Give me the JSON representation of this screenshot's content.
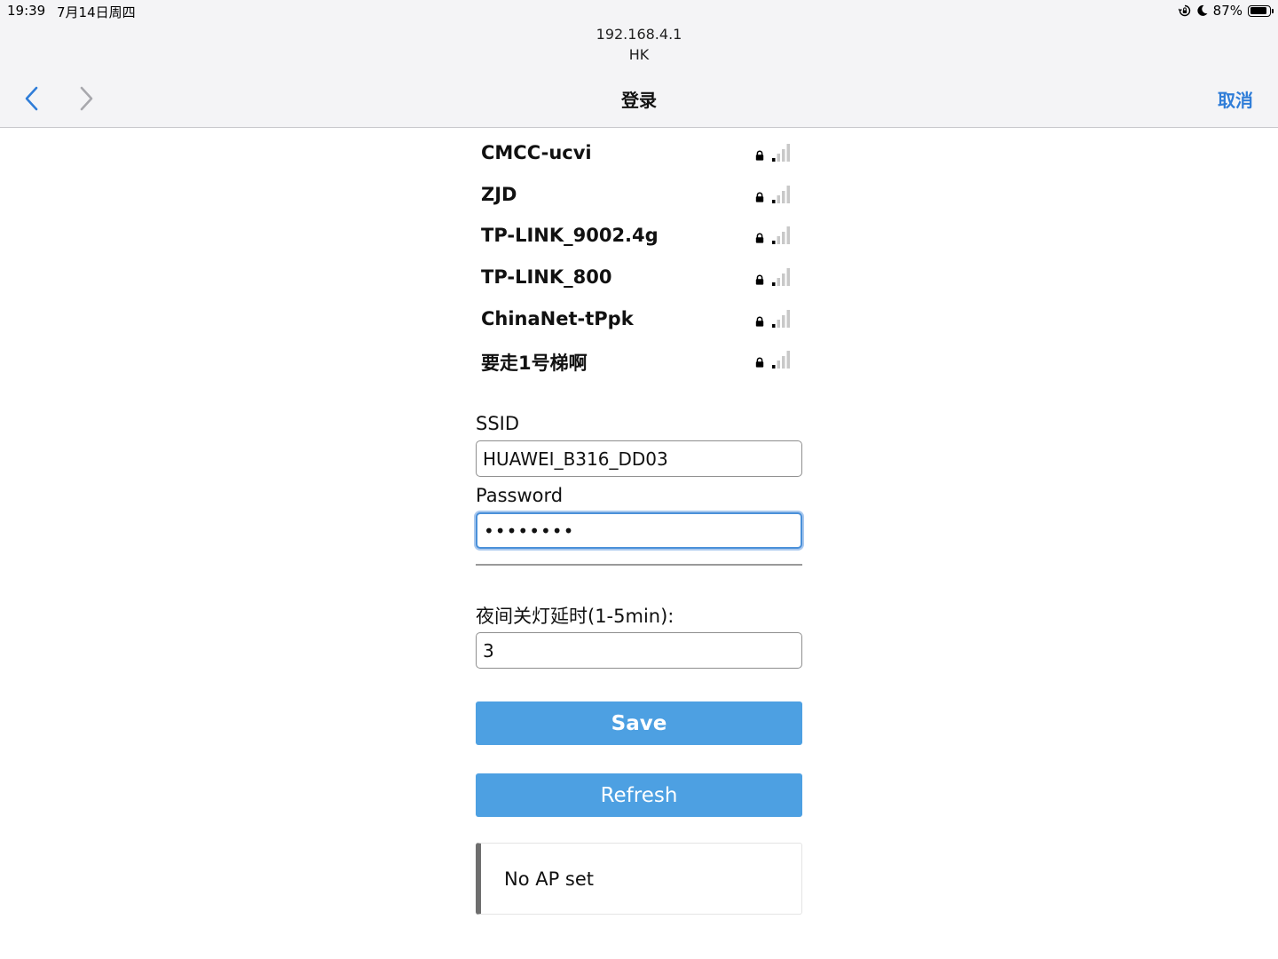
{
  "status_bar": {
    "time": "19:39",
    "date": "7月14日周四",
    "battery": "87%",
    "battery_level": 0.87,
    "icons": [
      "orientation-lock-icon",
      "moon-icon",
      "battery-icon"
    ]
  },
  "browser": {
    "url": "192.168.4.1",
    "site_name": "HK",
    "title": "登录",
    "cancel_label": "取消",
    "back_icon": "chevron-left-icon",
    "forward_icon": "chevron-right-icon"
  },
  "networks": [
    {
      "ssid": "CMCC-ucvi",
      "locked": true,
      "signal_bars": 1
    },
    {
      "ssid": "ZJD",
      "locked": true,
      "signal_bars": 1
    },
    {
      "ssid": "TP-LINK_9002.4g",
      "locked": true,
      "signal_bars": 1
    },
    {
      "ssid": "TP-LINK_800",
      "locked": true,
      "signal_bars": 1
    },
    {
      "ssid": "ChinaNet-tPpk",
      "locked": true,
      "signal_bars": 1
    },
    {
      "ssid": "要走1号梯啊",
      "locked": true,
      "signal_bars": 1
    }
  ],
  "form": {
    "ssid_label": "SSID",
    "ssid_value": "HUAWEI_B316_DD03",
    "password_label": "Password",
    "password_value": "••••••••",
    "delay_label": "夜间关灯延时(1-5min):",
    "delay_value": "3",
    "save_label": "Save",
    "refresh_label": "Refresh"
  },
  "message": {
    "text": "No AP set"
  },
  "colors": {
    "accent": "#4da0e2",
    "link": "#2f7dd8",
    "focus": "#4a90d9"
  }
}
